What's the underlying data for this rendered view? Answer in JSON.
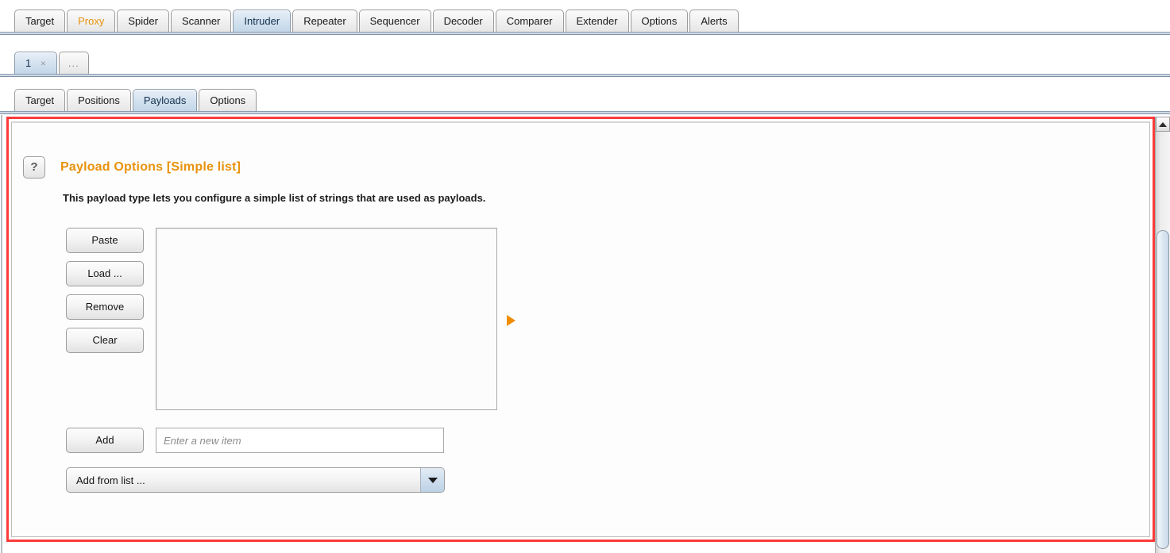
{
  "main_tabs": [
    {
      "label": "Target",
      "selected": false,
      "accent": false
    },
    {
      "label": "Proxy",
      "selected": false,
      "accent": true
    },
    {
      "label": "Spider",
      "selected": false,
      "accent": false
    },
    {
      "label": "Scanner",
      "selected": false,
      "accent": false
    },
    {
      "label": "Intruder",
      "selected": true,
      "accent": false
    },
    {
      "label": "Repeater",
      "selected": false,
      "accent": false
    },
    {
      "label": "Sequencer",
      "selected": false,
      "accent": false
    },
    {
      "label": "Decoder",
      "selected": false,
      "accent": false
    },
    {
      "label": "Comparer",
      "selected": false,
      "accent": false
    },
    {
      "label": "Extender",
      "selected": false,
      "accent": false
    },
    {
      "label": "Options",
      "selected": false,
      "accent": false
    },
    {
      "label": "Alerts",
      "selected": false,
      "accent": false
    }
  ],
  "attack_tabs": {
    "items": [
      {
        "label": "1",
        "closer": "×",
        "selected": true
      },
      {
        "label": "...",
        "closer": "",
        "selected": false
      }
    ]
  },
  "intruder_tabs": [
    {
      "label": "Target",
      "selected": false
    },
    {
      "label": "Positions",
      "selected": false
    },
    {
      "label": "Payloads",
      "selected": true
    },
    {
      "label": "Options",
      "selected": false
    }
  ],
  "payload_options": {
    "help_glyph": "?",
    "title": "Payload Options [Simple list]",
    "description": "This payload type lets you configure a simple list of strings that are used as payloads.",
    "buttons": [
      {
        "label": "Paste"
      },
      {
        "label": "Load ..."
      },
      {
        "label": "Remove"
      },
      {
        "label": "Clear"
      }
    ],
    "list_items": [],
    "add_button_label": "Add",
    "new_item_placeholder": "Enter a new item",
    "new_item_value": "",
    "add_from_list_label": "Add from list ..."
  },
  "scrollbar": {
    "up_arrow_name": "scroll-up-arrow"
  },
  "colors": {
    "accent_orange": "#e8920c",
    "marker_orange": "#f08c00",
    "highlight_red": "#fb3b3b",
    "selected_tab_blue": "#c3d7e8"
  }
}
